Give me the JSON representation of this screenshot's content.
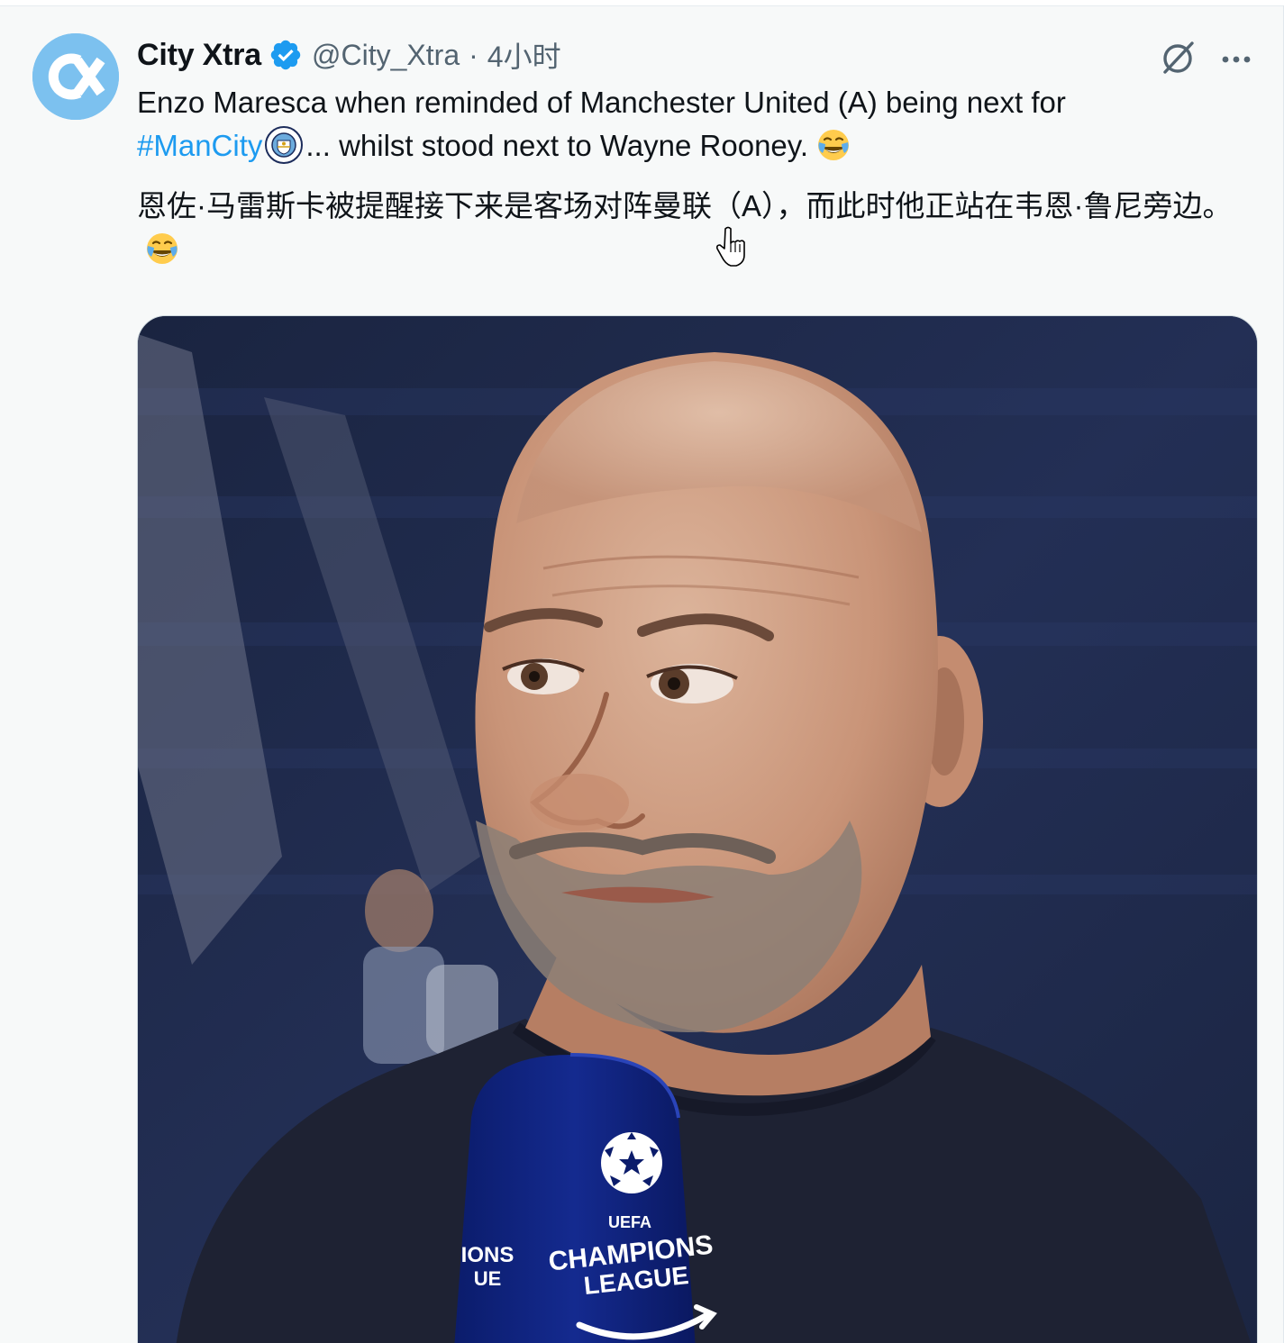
{
  "tweet": {
    "author": {
      "display_name": "City Xtra",
      "handle": "@City_Xtra",
      "separator": "·",
      "time": "4小时",
      "avatar_icon": "city-xtra-logo",
      "verified_icon": "verified-badge-icon"
    },
    "actions": {
      "grok_icon": "grok-icon",
      "more_icon": "more-icon"
    },
    "text": {
      "line1": "Enzo Maresca when reminded of Manchester United (A) being next for",
      "hashtag": "#ManCity",
      "line2_rest": "... whilst stood next to Wayne Rooney.",
      "emoji": "face-with-tears-of-joy"
    },
    "translation": {
      "text": "恩佐·马雷斯卡被提醒接下来是客场对阵曼联（A），而此时他正站在韦恩·鲁尼旁边。",
      "emoji": "face-with-tears-of-joy"
    },
    "media": {
      "microphone_text_line1": "CHAMPIONS",
      "microphone_text_line2": "LEAGUE",
      "microphone_side_line1": "IONS",
      "microphone_side_line2": "UE",
      "uefa_label": "UEFA"
    }
  },
  "colors": {
    "background": "#f7f9f9",
    "text": "#0f1419",
    "secondary_text": "#536471",
    "link": "#1d9bf0",
    "avatar_bg": "#7cc1ef"
  }
}
